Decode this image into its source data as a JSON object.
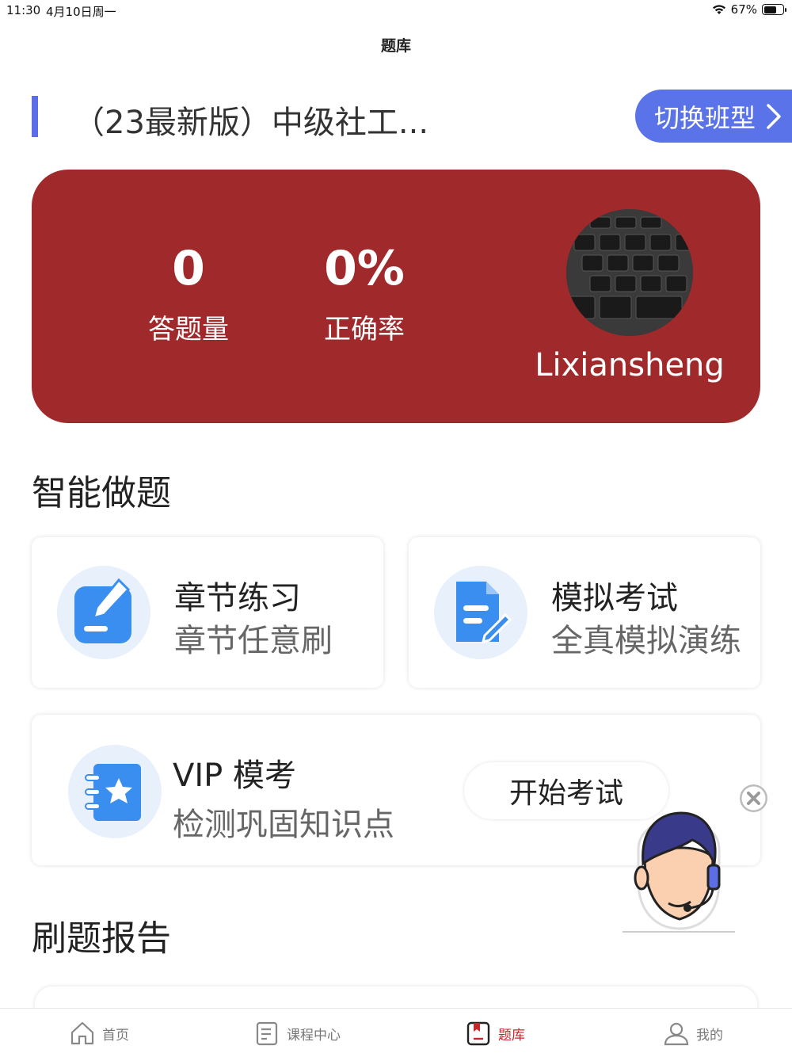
{
  "status_bar": {
    "time": "11:30",
    "date": "4月10日周一",
    "battery": "67%",
    "battery_level": 0.67
  },
  "nav": {
    "title": "题库"
  },
  "course": {
    "title": "（23最新版）中级社工...",
    "switch_label": "切换班型"
  },
  "stats": {
    "count_value": "0",
    "count_label": "答题量",
    "rate_value": "0%",
    "rate_label": "正确率",
    "username": "Lixiansheng"
  },
  "smart": {
    "heading": "智能做题",
    "chapter": {
      "title": "章节练习",
      "subtitle": "章节任意刷"
    },
    "mock": {
      "title": "模拟考试",
      "subtitle": "全真模拟演练"
    },
    "vip": {
      "title": "VIP 模考",
      "subtitle": "检测巩固知识点",
      "button": "开始考试"
    }
  },
  "report": {
    "heading": "刷题报告"
  },
  "tabs": [
    {
      "label": "首页",
      "icon": "home-icon"
    },
    {
      "label": "课程中心",
      "icon": "course-icon"
    },
    {
      "label": "题库",
      "icon": "question-bank-icon"
    },
    {
      "label": "我的",
      "icon": "profile-icon"
    }
  ],
  "colors": {
    "accent": "#5b73e8",
    "card": "#a0292b",
    "active_tab": "#c8262b",
    "icon_blue": "#3a8ef0"
  }
}
